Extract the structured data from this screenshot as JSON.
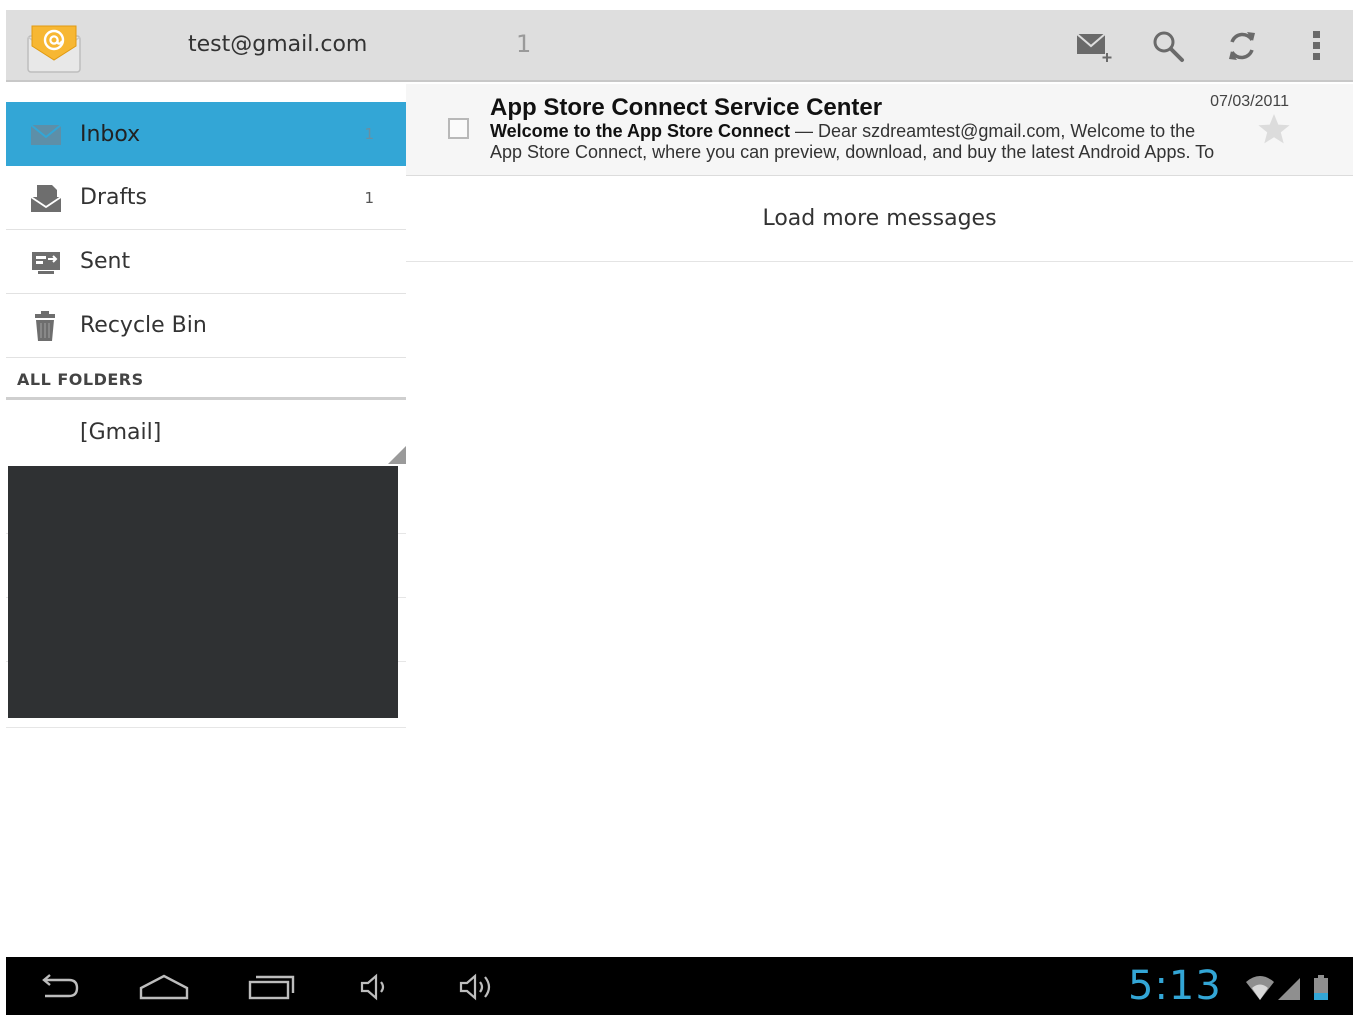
{
  "actionbar": {
    "account": "test@gmail.com",
    "unread_count": "1",
    "icons": [
      "compose-mail-icon",
      "search-icon",
      "refresh-icon",
      "overflow-menu-icon"
    ]
  },
  "folders": [
    {
      "label": "Inbox",
      "count": "1",
      "icon": "inbox-icon",
      "selected": true
    },
    {
      "label": "Drafts",
      "count": "1",
      "icon": "drafts-icon",
      "selected": false
    },
    {
      "label": "Sent",
      "count": "",
      "icon": "sent-icon",
      "selected": false
    },
    {
      "label": "Recycle Bin",
      "count": "",
      "icon": "trash-icon",
      "selected": false
    }
  ],
  "all_folders": {
    "header": "ALL FOLDERS",
    "items": [
      "[Gmail]"
    ]
  },
  "messages": [
    {
      "sender": "App Store Connect Service Center",
      "date": "07/03/2011",
      "subject": "Welcome to the App Store Connect",
      "separator": " — ",
      "preview": "Dear szdreamtest@gmail.com, Welcome to the App Store Connect, where you can preview, download, and buy the latest Android Apps. To",
      "starred": false
    }
  ],
  "load_more": "Load more messages",
  "systembar": {
    "clock": "5:13",
    "nav_icons": [
      "back-icon",
      "home-icon",
      "recent-apps-icon",
      "volume-down-icon",
      "volume-up-icon"
    ],
    "status_icons": [
      "wifi-icon",
      "signal-icon",
      "battery-icon"
    ]
  },
  "colors": {
    "accent": "#33a6d6",
    "actionbar_bg": "#dedede",
    "systembar_bg": "#000000"
  }
}
